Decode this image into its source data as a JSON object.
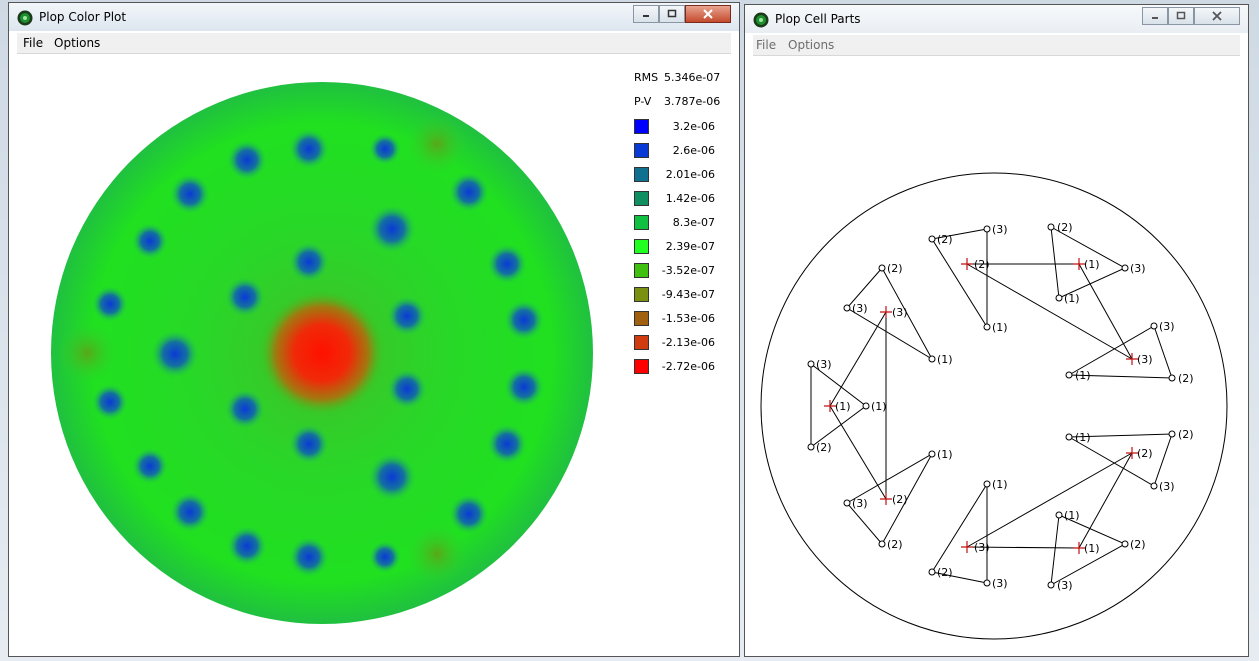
{
  "windows": {
    "color_plot": {
      "title": "Plop Color Plot",
      "menu": [
        "File",
        "Options"
      ],
      "stats": [
        {
          "label": "RMS",
          "value": "5.346e-07"
        },
        {
          "label": "P-V",
          "value": "3.787e-06"
        }
      ],
      "legend": [
        {
          "value": "3.2e-06",
          "color": "#0000ff"
        },
        {
          "value": "2.6e-06",
          "color": "#0a3ad6"
        },
        {
          "value": "2.01e-06",
          "color": "#107090"
        },
        {
          "value": "1.42e-06",
          "color": "#109060"
        },
        {
          "value": "8.3e-07",
          "color": "#10c040"
        },
        {
          "value": "2.39e-07",
          "color": "#20ff20"
        },
        {
          "value": "-3.52e-07",
          "color": "#40c010"
        },
        {
          "value": "-9.43e-07",
          "color": "#7a9010"
        },
        {
          "value": "-1.53e-06",
          "color": "#a06010"
        },
        {
          "value": "-2.13e-06",
          "color": "#d03c10"
        },
        {
          "value": "-2.72e-06",
          "color": "#ff0000"
        }
      ]
    },
    "cell_parts": {
      "title": "Plop Cell Parts",
      "menu": [
        "File",
        "Options"
      ]
    }
  },
  "icons": {
    "app": "plop-app-icon",
    "minimize": "minimize-icon",
    "maximize": "maximize-icon",
    "close": "close-icon"
  }
}
